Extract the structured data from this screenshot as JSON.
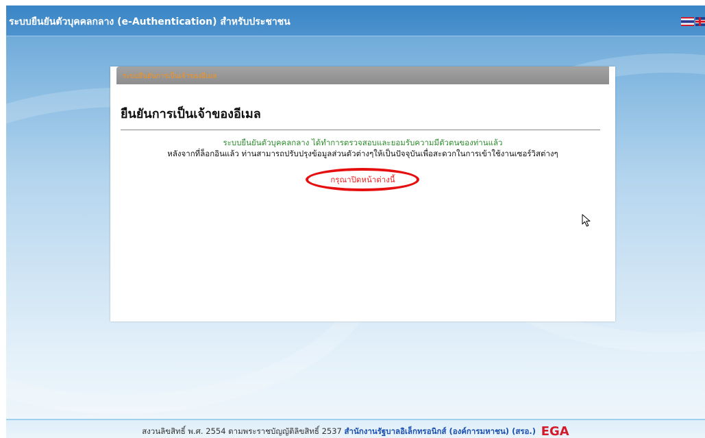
{
  "header": {
    "title": "ระบบยืนยันตัวบุคคลกลาง (e-Authentication) สำหรับประชาชน",
    "flags": [
      "thai-flag-icon",
      "uk-flag-icon"
    ]
  },
  "panel": {
    "tab_label": "ระบบยืนยันการเป็นเจ้าของอีเมล",
    "heading": "ยืนยันการเป็นเจ้าของอีเมล",
    "confirm_message": "ระบบยืนยันตัวบุคคลกลาง ได้ทำการตรวจสอบและยอมรับความมีตัวตนของท่านแล้ว",
    "info_message": "หลังจากที่ล็อกอินแล้ว ท่านสามารถปรับปรุงข้อมูลส่วนตัวต่างๆให้เป็นปัจจุบันเพื่อสะดวกในการเข้าใช้งานเซอร์วิสต่างๆ",
    "close_message": "กรุณาปิดหน้าต่างนี้"
  },
  "footer": {
    "copyright": "สงวนลิขสิทธิ์ พ.ศ. 2554 ตามพระราชบัญญัติลิขสิทธิ์ 2537",
    "agency_link": "สำนักงานรัฐบาลอิเล็กทรอนิกส์ (องค์การมหาชน) (สรอ.)",
    "logo": "EGA"
  },
  "colors": {
    "header_bg": "#3a85c5",
    "tab_label": "#f7931e",
    "confirm_text": "#2e8b2e",
    "close_text": "#ee2222",
    "annotation": "#e60f0f",
    "footer_link": "#1a4fb0",
    "footer_logo": "#d21a2a"
  }
}
